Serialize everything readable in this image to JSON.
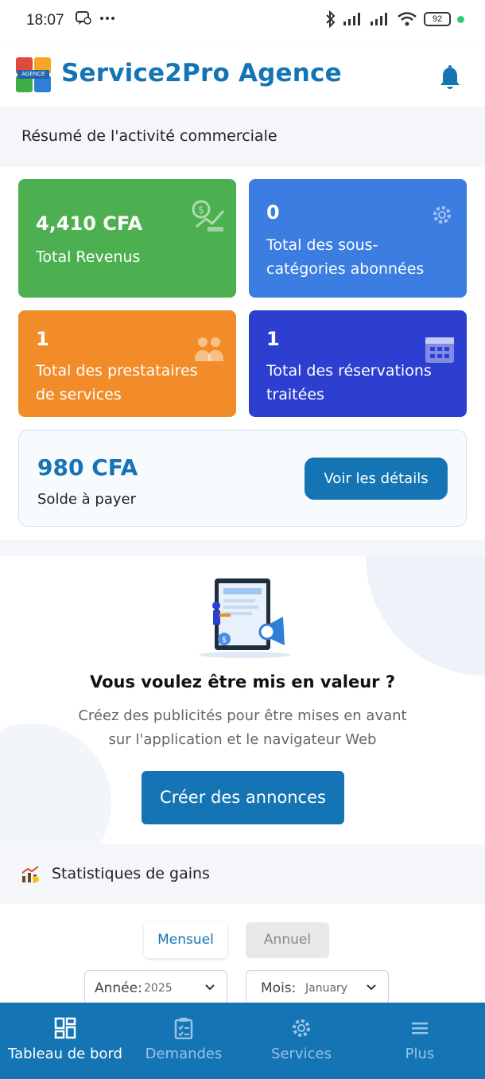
{
  "status_bar": {
    "time": "18:07",
    "battery": "92"
  },
  "header": {
    "title": "Service2Pro Agence",
    "logo_badge": "AGENCE"
  },
  "summary": {
    "title": "Résumé de l'activité commerciale",
    "cards": [
      {
        "value": "4,410 CFA",
        "label": "Total Revenus",
        "color": "#4caf50",
        "icon": "revenue-chart-icon"
      },
      {
        "value": "0",
        "label_line1": "Total des sous-",
        "label_line2": "catégories abonnées",
        "color": "#3b7de0",
        "icon": "gear-icon"
      },
      {
        "value": "1",
        "label_line1": "Total des prestataires",
        "label_line2": "de services",
        "color": "#f28c28",
        "icon": "people-icon"
      },
      {
        "value": "1",
        "label_line1": "Total des réservations",
        "label_line2": "traitées",
        "color": "#2d3fd1",
        "icon": "calendar-icon"
      }
    ],
    "balance": {
      "amount": "980 CFA",
      "label": "Solde à payer",
      "button": "Voir les détails"
    }
  },
  "promo": {
    "title": "Vous voulez être mis en valeur ?",
    "desc_line1": "Créez des publicités pour être mises en avant",
    "desc_line2": "sur l'application et le navigateur Web",
    "button": "Créer des annonces"
  },
  "stats": {
    "title": "Statistiques de gains",
    "tabs": [
      "Mensuel",
      "Annuel"
    ],
    "year_label": "Année:",
    "year_value": "2025",
    "month_label": "Mois:",
    "month_value": "January"
  },
  "bottom_nav": [
    {
      "label": "Tableau de bord",
      "icon": "dashboard-icon",
      "active": true
    },
    {
      "label": "Demandes",
      "icon": "clipboard-icon",
      "active": false
    },
    {
      "label": "Services",
      "icon": "gear-icon",
      "active": false
    },
    {
      "label": "Plus",
      "icon": "menu-icon",
      "active": false
    }
  ],
  "colors": {
    "primary": "#1474b4"
  }
}
